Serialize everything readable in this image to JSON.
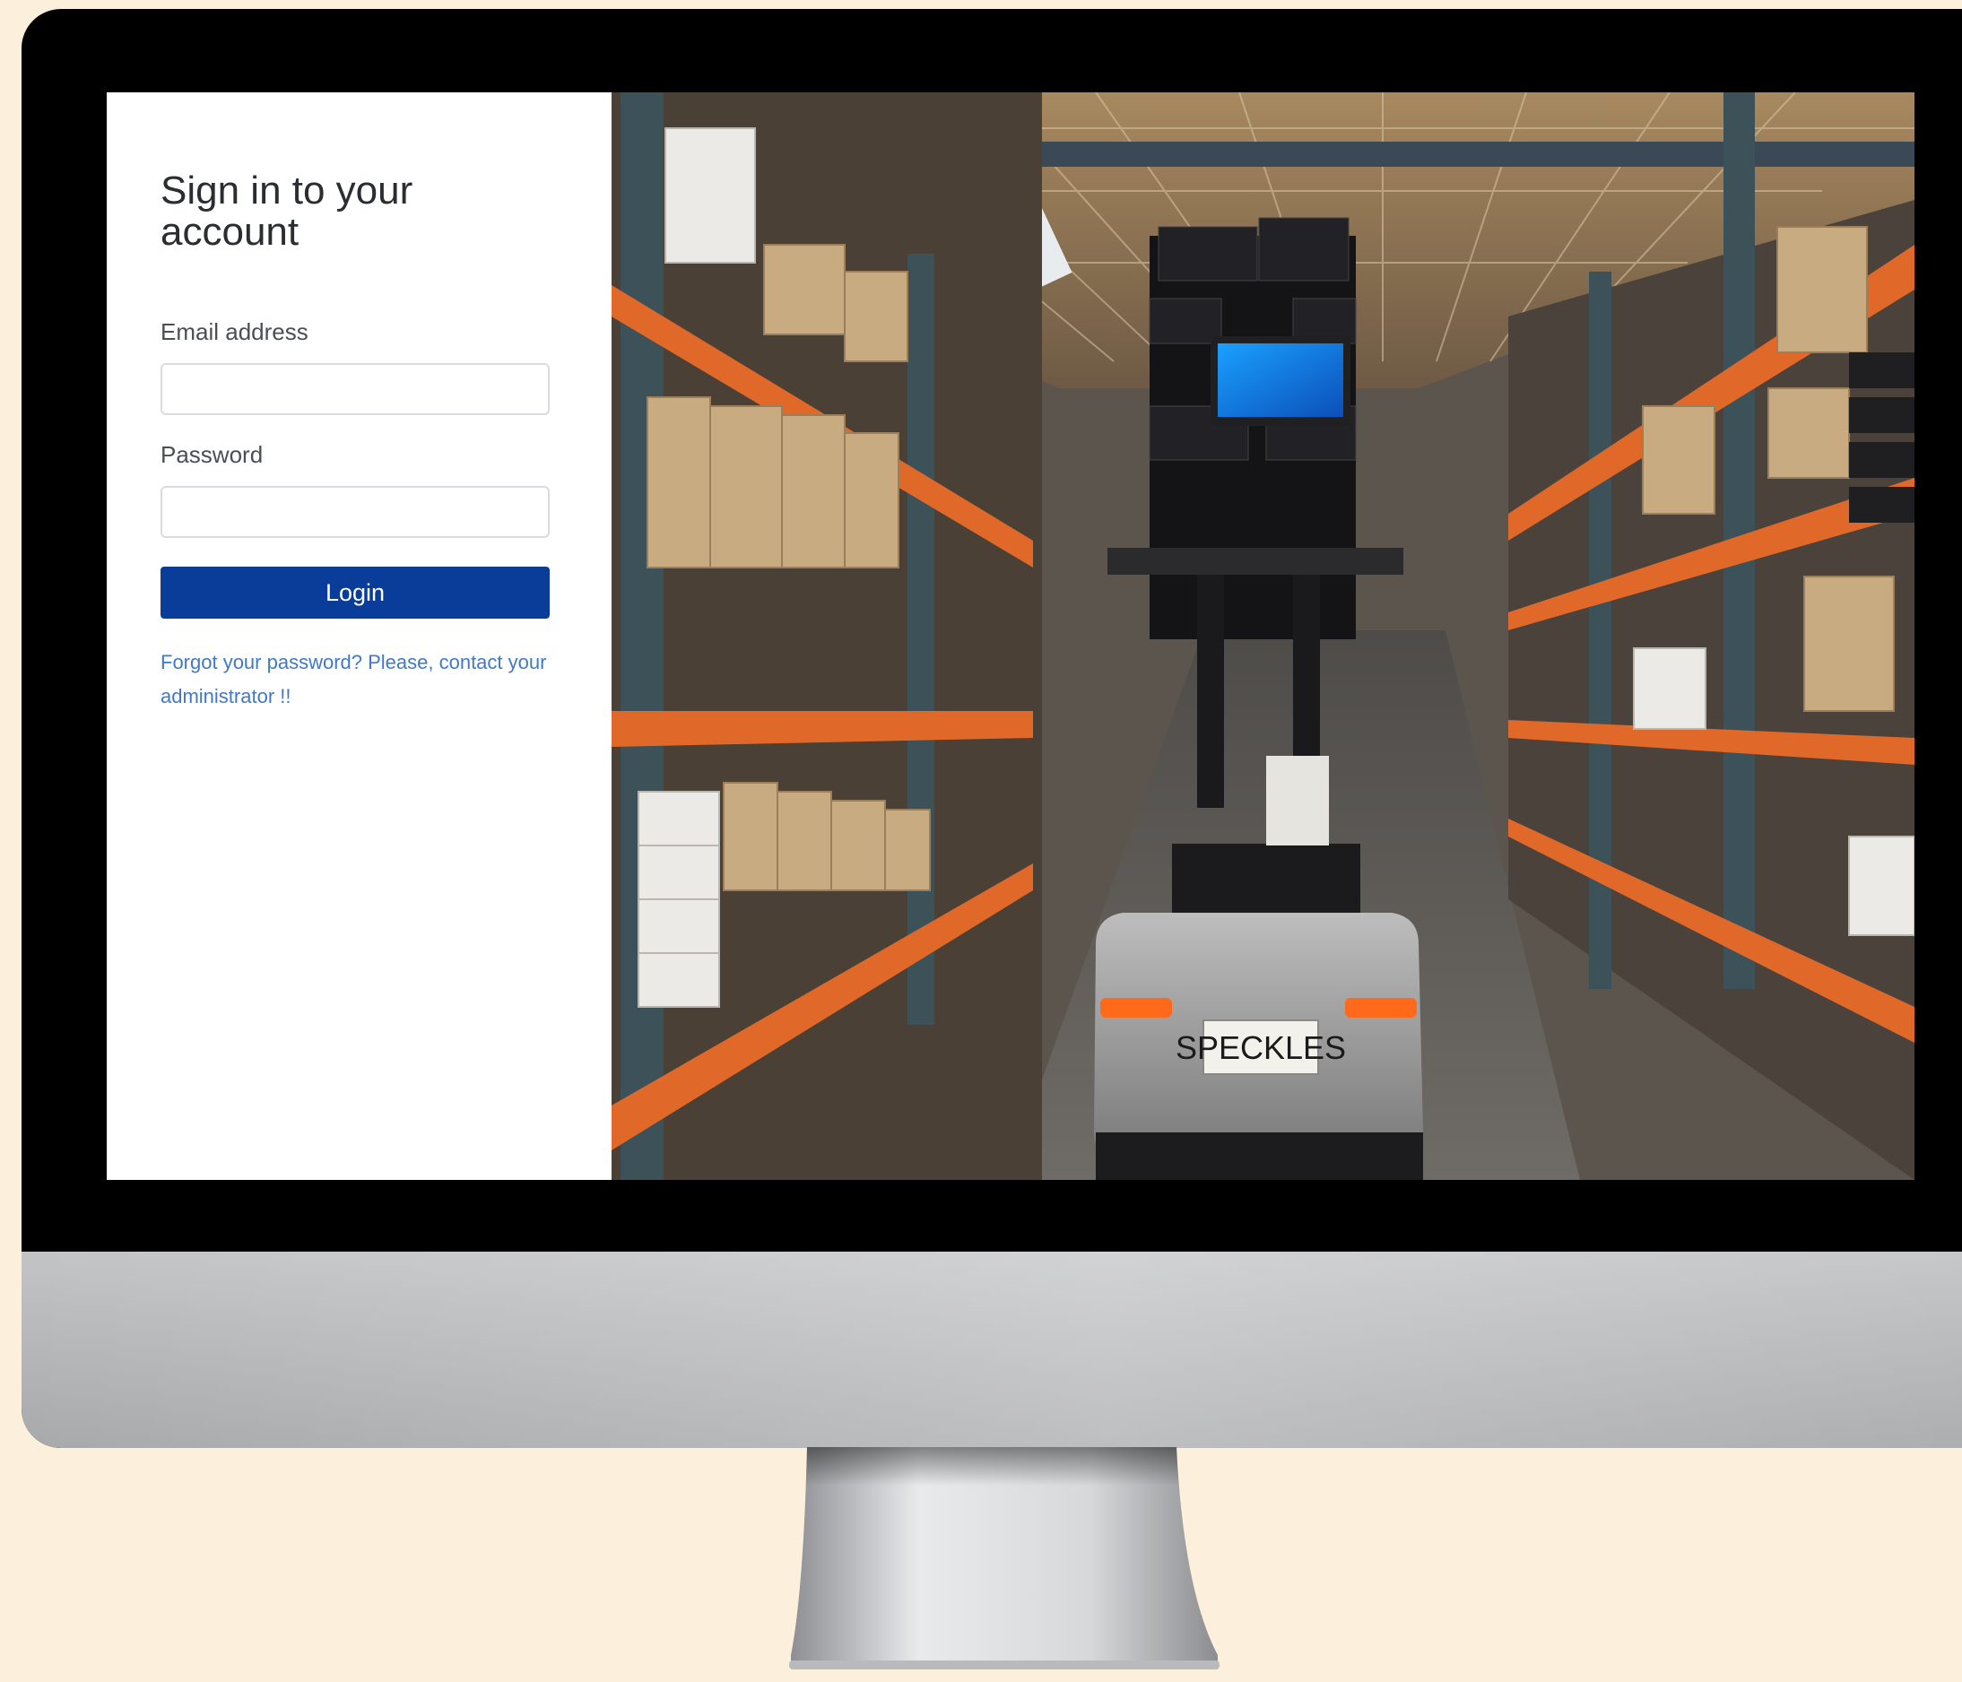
{
  "login": {
    "title": "Sign in to your account",
    "email_label": "Email address",
    "email_value": "",
    "password_label": "Password",
    "password_value": "",
    "login_label": "Login",
    "forgot_text": "Forgot your password? Please, contact your administrator !!"
  },
  "photo": {
    "robot_plate": "SPECKLES"
  },
  "colors": {
    "primary_button": "#0a3d99",
    "link": "#3f78cc",
    "shelving_orange": "#e0692a"
  }
}
